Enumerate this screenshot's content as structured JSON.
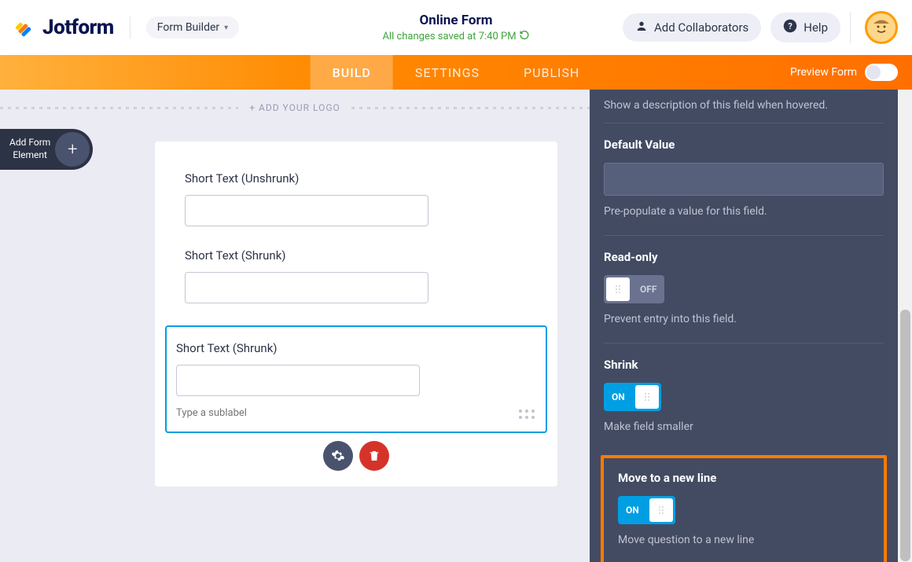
{
  "header": {
    "brand": "Jotform",
    "builder_label": "Form Builder",
    "form_title": "Online Form",
    "save_status": "All changes saved at 7:40 PM",
    "collab_label": "Add Collaborators",
    "help_label": "Help"
  },
  "tabs": {
    "build": "BUILD",
    "settings": "SETTINGS",
    "publish": "PUBLISH",
    "preview_label": "Preview Form"
  },
  "stage": {
    "add_logo": "+ ADD YOUR LOGO",
    "add_element_line1": "Add Form",
    "add_element_line2": "Element",
    "field1_label": "Short Text (Unshrunk)",
    "field2_label": "Short Text (Shrunk)",
    "field3_label": "Short Text (Shrunk)",
    "sublabel_placeholder": "Type a sublabel"
  },
  "props": {
    "hover_desc": "Show a description of this field when hovered.",
    "default_value_title": "Default Value",
    "default_value_help": "Pre-populate a value for this field.",
    "readonly_title": "Read-only",
    "readonly_state": "OFF",
    "readonly_help": "Prevent entry into this field.",
    "shrink_title": "Shrink",
    "shrink_state": "ON",
    "shrink_help": "Make field smaller",
    "newline_title": "Move to a new line",
    "newline_state": "ON",
    "newline_help": "Move question to a new line"
  }
}
